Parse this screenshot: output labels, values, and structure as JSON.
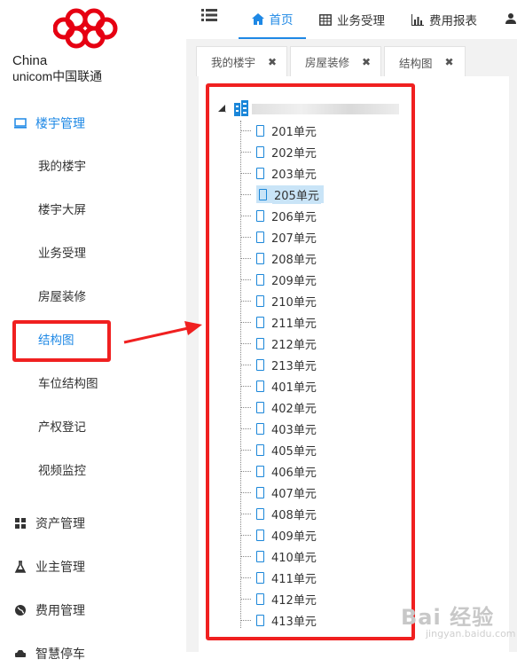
{
  "brand": {
    "line1": "China",
    "line2": "unicom中国联通"
  },
  "topnav": [
    {
      "label": "首页",
      "icon": "home-icon"
    },
    {
      "label": "业务受理",
      "icon": "table-icon"
    },
    {
      "label": "费用报表",
      "icon": "bar-chart-icon"
    }
  ],
  "tabs": [
    {
      "label": "我的楼宇",
      "close": "✖"
    },
    {
      "label": "房屋装修",
      "close": "✖"
    },
    {
      "label": "结构图",
      "close": "✖"
    }
  ],
  "sidebar": {
    "groups": [
      {
        "label": "楼宇管理",
        "icon": "monitor-icon"
      },
      {
        "label": "资产管理",
        "icon": "grid-icon"
      },
      {
        "label": "业主管理",
        "icon": "flask-icon"
      },
      {
        "label": "费用管理",
        "icon": "globe-icon"
      },
      {
        "label": "智慧停车",
        "icon": "car-icon"
      }
    ],
    "subitems": [
      {
        "label": "我的楼宇"
      },
      {
        "label": "楼宇大屏"
      },
      {
        "label": "业务受理"
      },
      {
        "label": "房屋装修"
      },
      {
        "label": "结构图"
      },
      {
        "label": "车位结构图"
      },
      {
        "label": "产权登记"
      },
      {
        "label": "视频监控"
      }
    ]
  },
  "tree": {
    "nodes": [
      "201单元",
      "202单元",
      "203单元",
      "205单元",
      "206单元",
      "207单元",
      "208单元",
      "209单元",
      "210单元",
      "211单元",
      "212单元",
      "213单元",
      "401单元",
      "402单元",
      "403单元",
      "405单元",
      "406单元",
      "407单元",
      "408单元",
      "409单元",
      "410单元",
      "411单元",
      "412单元",
      "413单元"
    ],
    "selected": "205单元"
  },
  "colors": {
    "accent": "#1e88e5",
    "highlight": "#f02020",
    "selected_bg": "#c9e4f7"
  },
  "watermark": {
    "main": "Bai 经验",
    "sub": "jingyan.baidu.com"
  }
}
